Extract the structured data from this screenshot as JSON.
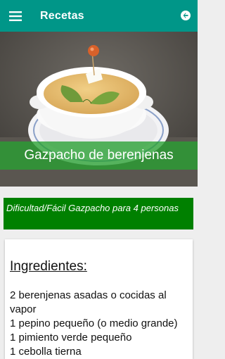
{
  "appbar": {
    "title": "Recetas",
    "menu_icon": "hamburger-menu-icon",
    "back_icon": "back-arrow-circle-icon"
  },
  "hero": {
    "caption": "Gazpacho de berenjenas"
  },
  "difficulty": {
    "text": "Dificultad/Fácil Gazpacho para 4 personas"
  },
  "ingredients": {
    "heading": "Ingredientes:",
    "items": [
      "2 berenjenas asadas o cocidas al vapor",
      "1 pepino pequeño (o medio grande)",
      "1 pimiento verde pequeño",
      "1 cebolla tierna"
    ]
  },
  "colors": {
    "appbar": "#009688",
    "caption_bg": "#28a032",
    "difficulty_bg": "#008000"
  }
}
